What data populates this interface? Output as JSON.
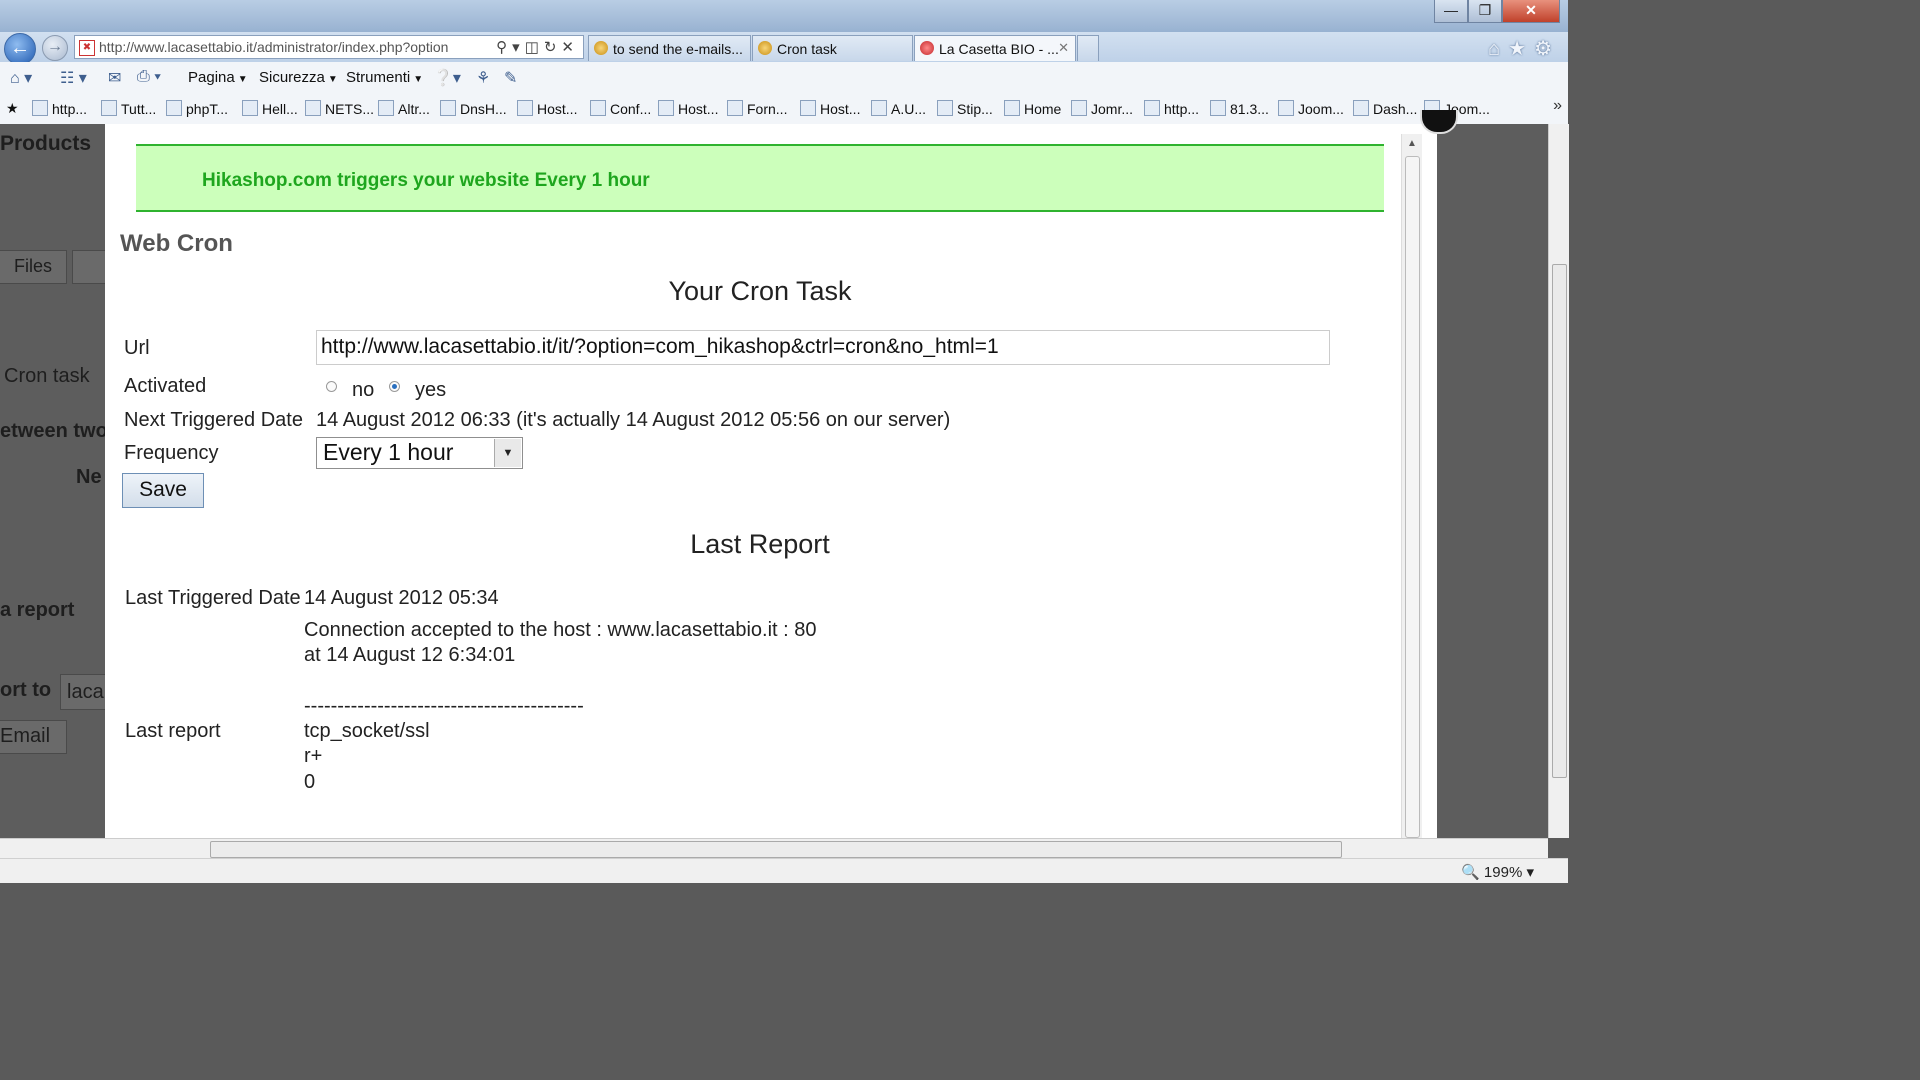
{
  "browser": {
    "address": "http://www.lacasettabio.it/administrator/index.php?option",
    "tabs": [
      {
        "label": "to send the e-mails..."
      },
      {
        "label": "Cron task"
      },
      {
        "label": "La Casetta BIO - ..."
      }
    ],
    "command_bar": {
      "pagina": "Pagina",
      "sicurezza": "Sicurezza",
      "strumenti": "Strumenti"
    },
    "favorites": [
      "http...",
      "Tutt...",
      "phpT...",
      "Hell...",
      "NETS...",
      "Altr...",
      "DnsH...",
      "Host...",
      "Conf...",
      "Host...",
      "Forn...",
      "Host...",
      "A.U...",
      "Stip...",
      "Home",
      "Jomr...",
      "http...",
      "81.3...",
      "Joom...",
      "Dash...",
      "Joom..."
    ],
    "zoom": "199%"
  },
  "background_page": {
    "products": "Products",
    "files_tab": "Files",
    "cron_task": "Cron task",
    "between": "etween two",
    "next": "Ne",
    "a_report": "a report",
    "report_to": "ort to",
    "report_to_value": "laca",
    "email": "Email"
  },
  "modal": {
    "banner": "Hikashop.com triggers your website Every 1 hour",
    "section_title": "Web Cron",
    "cron_task_heading": "Your Cron Task",
    "url_label": "Url",
    "url_value": "http://www.lacasettabio.it/it/?option=com_hikashop&ctrl=cron&no_html=1",
    "activated_label": "Activated",
    "activated_no": "no",
    "activated_yes": "yes",
    "activated_value": "yes",
    "next_triggered_label": "Next Triggered Date",
    "next_triggered_value": "14 August 2012 06:33 (it's actually 14 August 2012 05:56 on our server)",
    "frequency_label": "Frequency",
    "frequency_value": "Every 1 hour",
    "save_button": "Save",
    "last_report_heading": "Last Report",
    "last_triggered_label": "Last Triggered Date",
    "last_triggered_value": "14 August 2012 05:34",
    "last_report_label": "Last report",
    "last_report_lines": "Connection accepted to the host : www.lacasettabio.it : 80\nat 14 August 12 6:34:01\n\n------------------------------------------\ntcp_socket/ssl\nr+\n0"
  }
}
